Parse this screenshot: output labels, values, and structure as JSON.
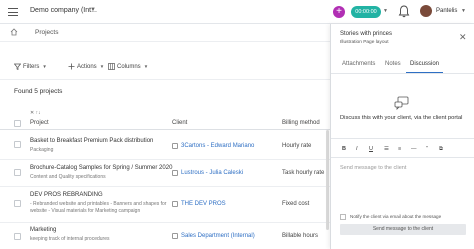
{
  "header": {
    "company": "Demo company (Int...",
    "timer": "00:00:00",
    "user": "Pantelis"
  },
  "breadcrumb": {
    "current": "Projects"
  },
  "toolbar": {
    "filters": "Filters",
    "actions": "Actions",
    "columns": "Columns"
  },
  "summary": {
    "found": "Found 5 projects"
  },
  "table": {
    "columns": [
      "Project",
      "Client",
      "Billing method"
    ],
    "rows": [
      {
        "title": "Basket to Breakfast Premium Pack distribution",
        "sub": "Packaging",
        "client": "3Cartons - Edward Mariano",
        "billing": "Hourly rate"
      },
      {
        "title": "Brochure-Catalog Samples for Spring / Summer 2020",
        "sub": "Content and Quality specifications",
        "client": "Lustrous - Julia Caleski",
        "billing": "Task hourly rate"
      },
      {
        "title": "DEV PROS REBRANDING",
        "sub": "- Rebranded website and printables - Banners and shapes for",
        "sub2": "website - Visual materials for Marketing campaign",
        "client": "THE DEV PROS",
        "billing": "Fixed cost"
      },
      {
        "title": "Marketing",
        "sub": "keeping track of internal procedures",
        "client": "Sales Department (Internal)",
        "billing": "Billable hours"
      }
    ]
  },
  "panel": {
    "title": "Stories with princes",
    "subtitle": "Illustration Page layout",
    "tabs": [
      "Attachments",
      "Notes",
      "Discussion"
    ],
    "active_tab": "Discussion",
    "message": "Discuss this with your client, via the client portal",
    "formatting": [
      "B",
      "I",
      "U",
      "☰",
      "≡",
      "—",
      "”",
      "⧉"
    ],
    "send_placeholder": "Send message to the client",
    "notify_label": "Notify the client via email about the message",
    "send_button": "Send message to the client"
  }
}
